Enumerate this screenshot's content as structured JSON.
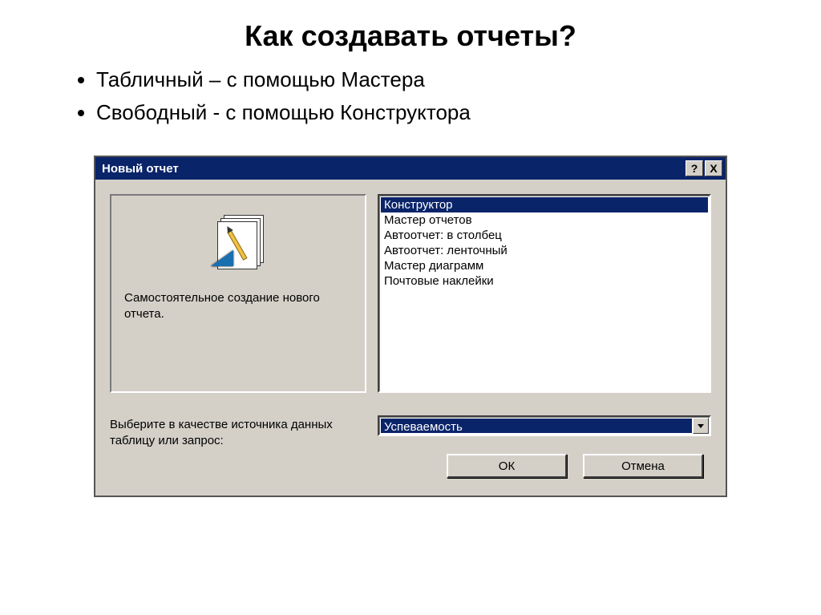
{
  "slide": {
    "title": "Как создавать отчеты?",
    "bullets": [
      "Табличный – с помощью Мастера",
      "Свободный - с помощью Конструктора"
    ]
  },
  "dialog": {
    "title": "Новый отчет",
    "help_btn": "?",
    "close_btn": "X",
    "preview_text": "Самостоятельное создание нового отчета.",
    "list_items": [
      "Конструктор",
      "Мастер отчетов",
      "Автоотчет: в столбец",
      "Автоотчет: ленточный",
      "Мастер диаграмм",
      "Почтовые наклейки"
    ],
    "selected_index": 0,
    "source_label": "Выберите в качестве источника данных таблицу или запрос:",
    "combo_value": "Успеваемость",
    "ok_label": "ОК",
    "cancel_label": "Отмена"
  }
}
